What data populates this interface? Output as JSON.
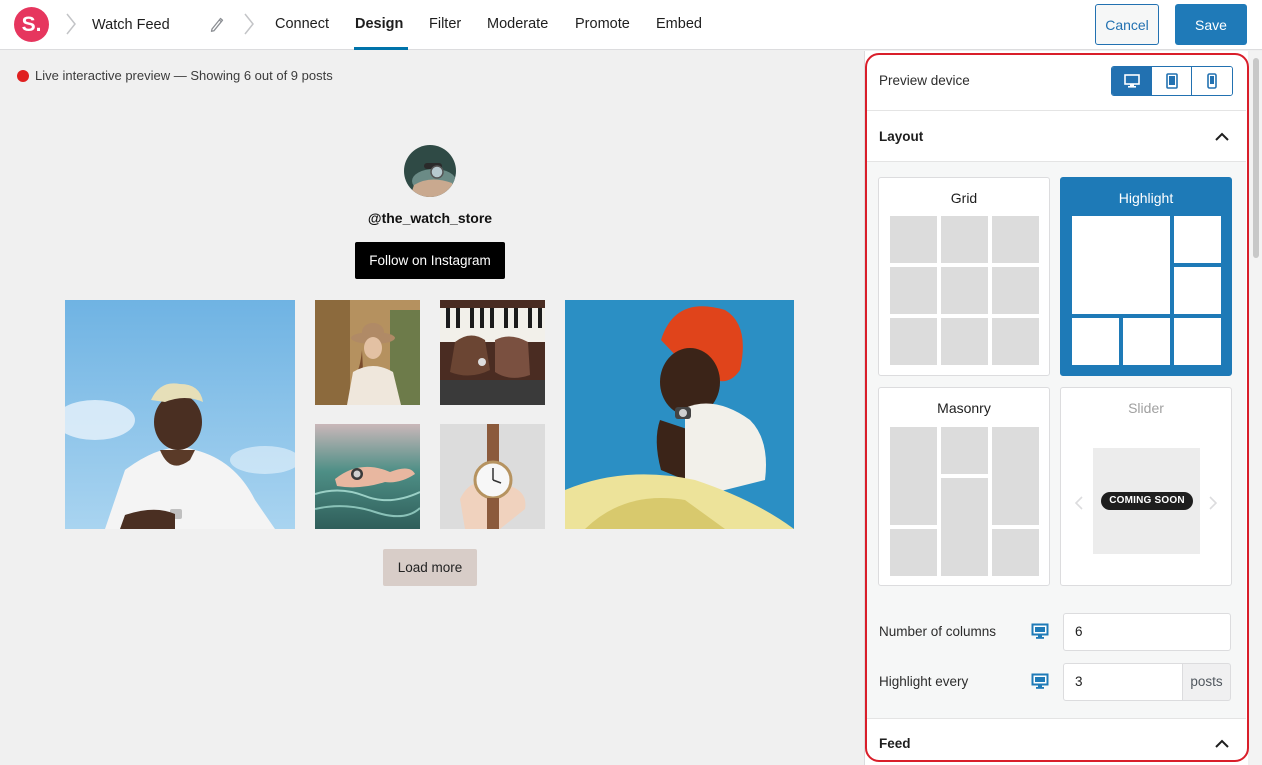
{
  "header": {
    "logo_text": "S.",
    "feed_name": "Watch Feed",
    "tabs": [
      {
        "label": "Connect",
        "active": false
      },
      {
        "label": "Design",
        "active": true
      },
      {
        "label": "Filter",
        "active": false
      },
      {
        "label": "Moderate",
        "active": false
      },
      {
        "label": "Promote",
        "active": false
      },
      {
        "label": "Embed",
        "active": false
      }
    ],
    "cancel_label": "Cancel",
    "save_label": "Save",
    "accent_color": "#2271b1",
    "brand_color": "#e6365e"
  },
  "preview": {
    "status_text": "Live interactive preview — Showing 6 out of 9 posts",
    "status_color": "#e02020",
    "username": "@the_watch_store",
    "follow_label": "Follow on Instagram",
    "load_more_label": "Load more",
    "posts": [
      {
        "name": "man-in-white-shirt-photo"
      },
      {
        "name": "woman-in-hat-photo"
      },
      {
        "name": "piano-hands-photo"
      },
      {
        "name": "hand-in-water-photo"
      },
      {
        "name": "hand-holding-watch-photo"
      },
      {
        "name": "woman-red-headwrap-photo"
      }
    ]
  },
  "sidebar": {
    "preview_device_label": "Preview device",
    "devices": [
      {
        "icon": "desktop-icon",
        "active": true
      },
      {
        "icon": "tablet-icon",
        "active": false
      },
      {
        "icon": "phone-icon",
        "active": false
      }
    ],
    "layout_section": {
      "title": "Layout",
      "expanded": true,
      "options": [
        {
          "label": "Grid",
          "selected": false
        },
        {
          "label": "Highlight",
          "selected": true
        },
        {
          "label": "Masonry",
          "selected": false
        },
        {
          "label": "Slider",
          "selected": false,
          "badge": "COMING SOON"
        }
      ],
      "columns_label": "Number of columns",
      "columns_value": "6",
      "highlight_label": "Highlight every",
      "highlight_value": "3",
      "highlight_suffix": "posts"
    },
    "feed_section": {
      "title": "Feed",
      "expanded": true
    }
  }
}
